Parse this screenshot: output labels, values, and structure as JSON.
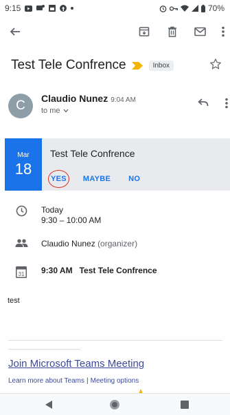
{
  "status_bar": {
    "time": "9:15",
    "battery": "70%"
  },
  "toolbar": {
    "icons": [
      "back-arrow-icon",
      "archive-icon",
      "delete-icon",
      "mail-icon",
      "more-vert-icon"
    ]
  },
  "email": {
    "subject": "Test Tele Confrence",
    "label": "Inbox",
    "sender_initial": "C",
    "sender_name": "Claudio Nunez",
    "sent_time": "9:04 AM",
    "recipient_text": "to me"
  },
  "invite": {
    "month": "Mar",
    "day": "18",
    "title": "Test Tele Confrence",
    "rsvp": {
      "yes": "YES",
      "maybe": "MAYBE",
      "no": "NO"
    },
    "selected_rsvp": "YES"
  },
  "details": {
    "day": "Today",
    "time_range": "9:30 – 10:00 AM",
    "organizer_name": "Claudio Nunez",
    "organizer_tag": "(organizer)",
    "calendar_icon_day": "31",
    "calendar_time": "9:30 AM",
    "calendar_title": "Test Tele Confrence"
  },
  "body": {
    "text": "test",
    "teams_link": "Join Microsoft Teams Meeting",
    "learn_more": "Learn more about Teams",
    "separator": "|",
    "meeting_options": "Meeting options"
  },
  "colors": {
    "accent": "#1a73e8",
    "date_block": "#1a73e8",
    "invite_bg": "#e8eaed",
    "rsvp_circle": "#d93025",
    "importance_marker": "#f4b400",
    "teams_link": "#3c4a9a",
    "avatar": "#8d9ea8"
  }
}
